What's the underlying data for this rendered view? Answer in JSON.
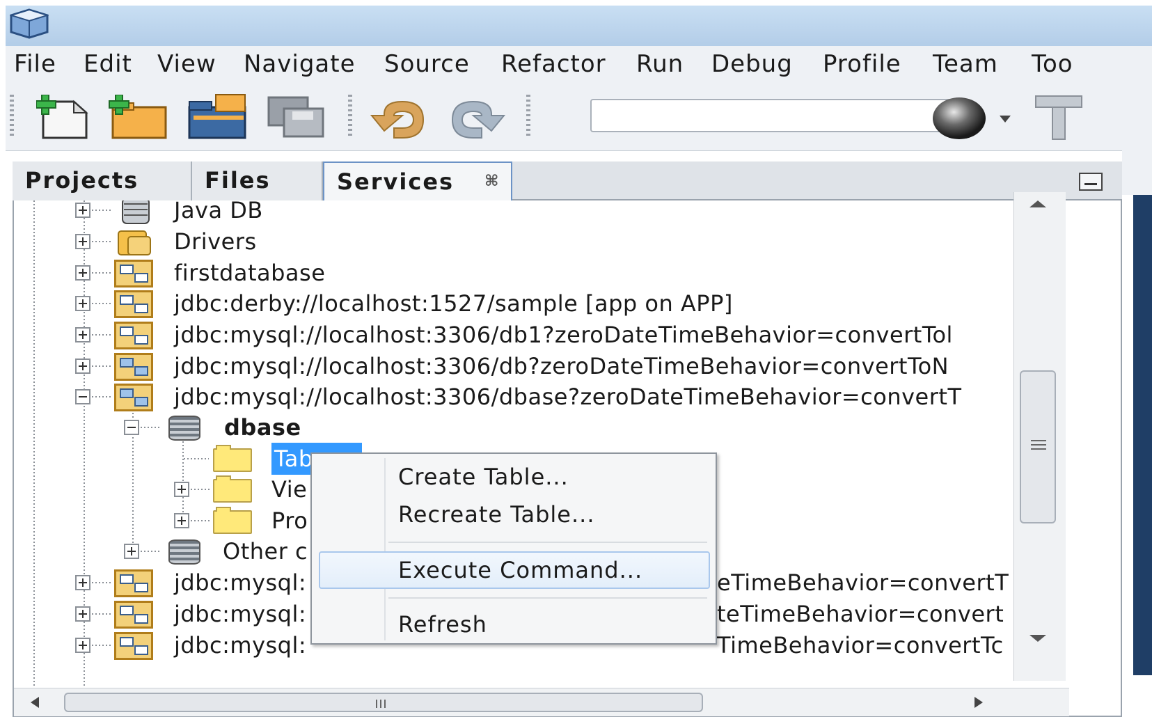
{
  "menubar": {
    "items": [
      "File",
      "Edit",
      "View",
      "Navigate",
      "Source",
      "Refactor",
      "Run",
      "Debug",
      "Profile",
      "Team",
      "Too"
    ]
  },
  "toolbar": {
    "buttons": [
      "new-file-icon",
      "new-project-icon",
      "open-project-icon",
      "save-all-icon",
      "undo-icon",
      "redo-icon",
      "browser-globe-icon",
      "build-hammer-icon"
    ],
    "config_value": ""
  },
  "tabs": {
    "projects": "Projects",
    "files": "Files",
    "services": "Services",
    "services_close": "⌘"
  },
  "tree": {
    "java_db": "Java DB",
    "drivers": "Drivers",
    "firstdatabase": "firstdatabase",
    "conn_derby": "jdbc:derby://localhost:1527/sample [app on APP]",
    "conn_db1": "jdbc:mysql://localhost:3306/db1?zeroDateTimeBehavior=convertTol",
    "conn_db": "jdbc:mysql://localhost:3306/db?zeroDateTimeBehavior=convertToN",
    "conn_dbase": "jdbc:mysql://localhost:3306/dbase?zeroDateTimeBehavior=convertT",
    "schema_dbase": "dbase",
    "tables": "Tab",
    "views": "Vie",
    "procedures": "Pro",
    "other": "Other c",
    "conn_more1_left": "jdbc:mysql:",
    "conn_more1_right": "eTimeBehavior=convertT",
    "conn_more2_left": "jdbc:mysql:",
    "conn_more2_right": "teTimeBehavior=convert",
    "conn_more3_left": "jdbc:mysql:",
    "conn_more3_right": "TimeBehavior=convertTc"
  },
  "context_menu": {
    "create_table": "Create Table...",
    "recreate_table": "Recreate Table...",
    "execute_command": "Execute Command...",
    "refresh": "Refresh"
  },
  "colors": {
    "selection": "#3399ff",
    "title_bar": "#c9dff3",
    "menu_highlight": "#a9c7ec"
  }
}
